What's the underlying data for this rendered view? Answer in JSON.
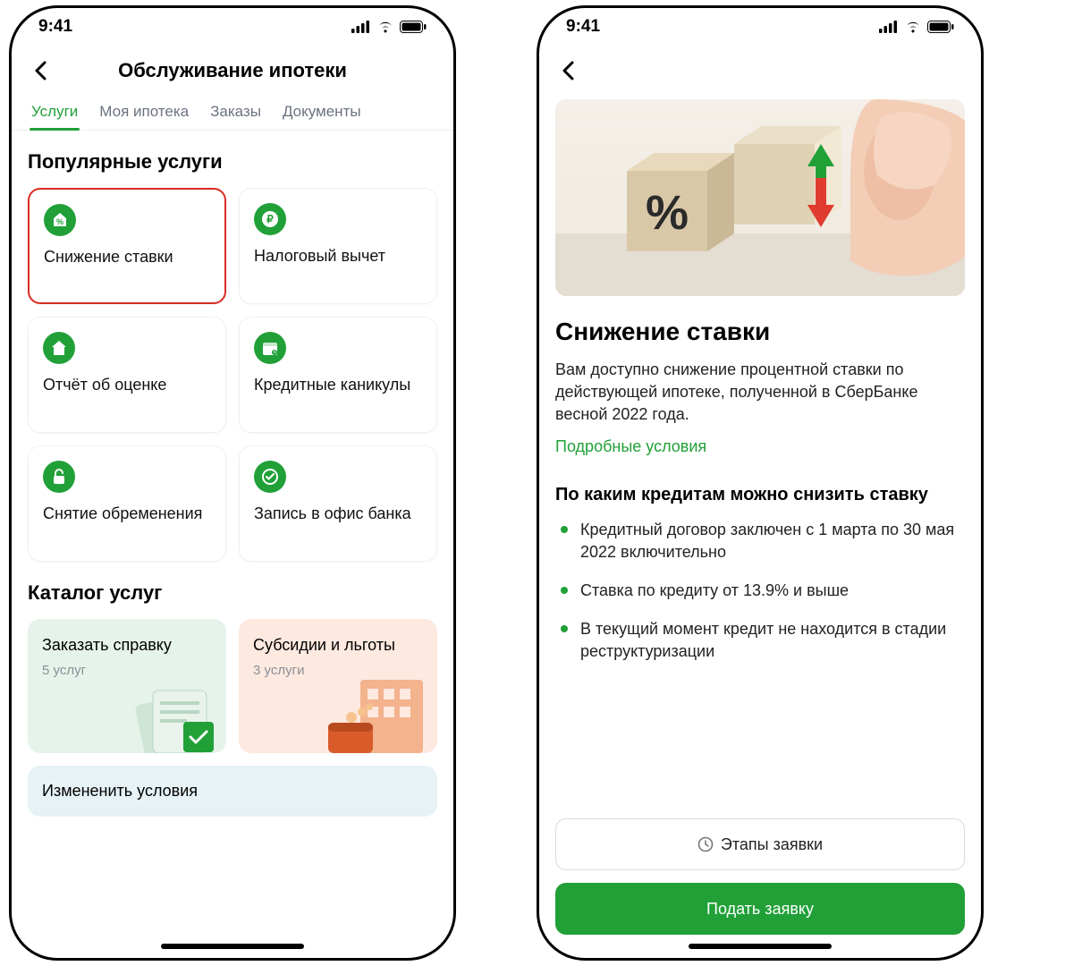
{
  "status": {
    "time": "9:41"
  },
  "screenA": {
    "title": "Обслуживание ипотеки",
    "tabs": [
      "Услуги",
      "Моя ипотека",
      "Заказы",
      "Документы"
    ],
    "active_tab": 0,
    "section_popular": "Популярные услуги",
    "cards": [
      {
        "label": "Снижение ставки",
        "icon": "percent-house-icon",
        "highlight": true
      },
      {
        "label": "Налоговый вычет",
        "icon": "ruble-icon",
        "highlight": false
      },
      {
        "label": "Отчёт об оценке",
        "icon": "house-icon",
        "highlight": false
      },
      {
        "label": "Кредитные каникулы",
        "icon": "calendar-icon",
        "highlight": false
      },
      {
        "label": "Снятие обременения",
        "icon": "unlock-icon",
        "highlight": false
      },
      {
        "label": "Запись в офис банка",
        "icon": "check-circle-icon",
        "highlight": false
      }
    ],
    "section_catalog": "Каталог услуг",
    "catalog": [
      {
        "title": "Заказать справку",
        "sub": "5 услуг",
        "tone": "green"
      },
      {
        "title": "Субсидии и льготы",
        "sub": "3 услуги",
        "tone": "peach"
      }
    ],
    "wide_card": "Измененить условия"
  },
  "screenB": {
    "title": "Снижение ставки",
    "paragraph": "Вам доступно снижение процентной ставки по действующей ипотеке, полученной в СберБанке весной 2022 года.",
    "link": "Подробные условия",
    "sub_title": "По каким кредитам можно снизить ставку",
    "bullets": [
      "Кредитный договор заключен с 1 марта по 30 мая 2022 включительно",
      "Ставка по кредиту от 13.9% и выше",
      "В текущий момент кредит не находится в стадии реструктуризации"
    ],
    "btn_stages": "Этапы заявки",
    "btn_submit": "Подать заявку"
  }
}
